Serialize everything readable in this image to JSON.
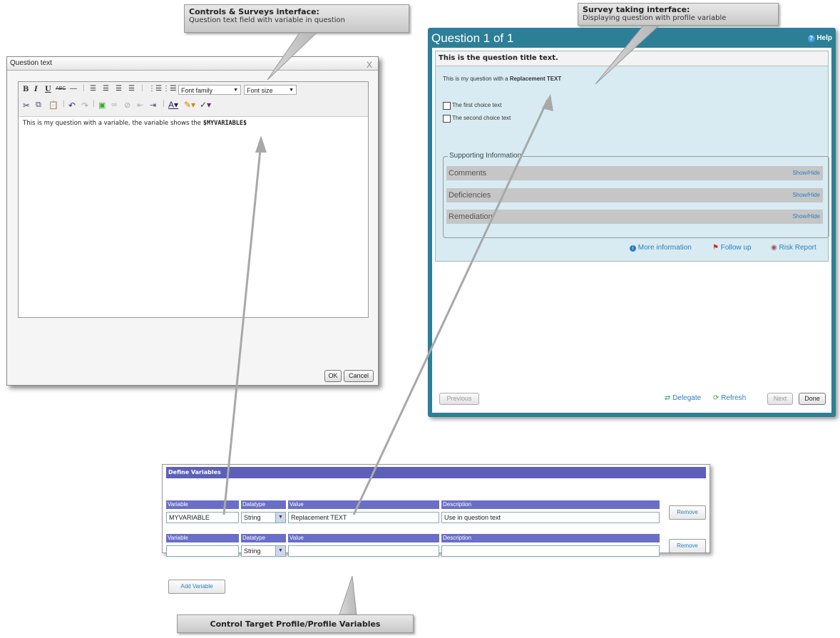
{
  "callouts": {
    "controls": {
      "title": "Controls & Surveys interface:",
      "subtitle": "Question text field with variable in question"
    },
    "survey": {
      "title": "Survey taking interface:",
      "subtitle": "Displaying question with profile variable"
    },
    "profile": {
      "title": "Control Target Profile/Profile Variables"
    }
  },
  "question_text_dialog": {
    "title": "Question text",
    "close": "X",
    "toolbar": {
      "bold": "B",
      "italic": "I",
      "underline": "U",
      "strike": "ABC",
      "font_family": "Font family",
      "font_size": "Font size"
    },
    "content_prefix": "This is my question with a variable, the variable shows the ",
    "content_variable": "$MYVARIABLE$",
    "ok": "OK",
    "cancel": "Cancel"
  },
  "survey": {
    "header": "Question 1 of 1",
    "help": "Help",
    "question_title": "This is the question title text.",
    "question_prefix": "This is my question with a ",
    "question_replacement": "Replacement TEXT",
    "choices": [
      "The first choice text",
      "The second choice text"
    ],
    "supporting_label": "Supporting Information",
    "supporting_items": [
      "Comments",
      "Deficiencies",
      "Remediation"
    ],
    "show_hide": "Show/Hide",
    "links": {
      "more_info": "More information",
      "follow_up": "Follow up",
      "risk_report": "Risk Report"
    },
    "footer": {
      "previous": "Previous",
      "delegate": "Delegate",
      "refresh": "Refresh",
      "next": "Next",
      "done": "Done"
    }
  },
  "define_variables": {
    "header": "Define Variables",
    "columns": {
      "variable": "Variable",
      "datatype": "Datatype",
      "value": "Value",
      "description": "Description"
    },
    "rows": [
      {
        "variable": "MYVARIABLE",
        "datatype": "String",
        "value": "Replacement TEXT",
        "description": "Use in question text"
      },
      {
        "variable": "",
        "datatype": "String",
        "value": "",
        "description": ""
      }
    ],
    "remove": "Remove",
    "add_variable": "Add Variable"
  },
  "colors": {
    "survey_teal": "#2c7f97",
    "panel_blue": "#d8ebf3",
    "vars_header": "#5c60b8",
    "link_blue": "#2a7fbf"
  }
}
